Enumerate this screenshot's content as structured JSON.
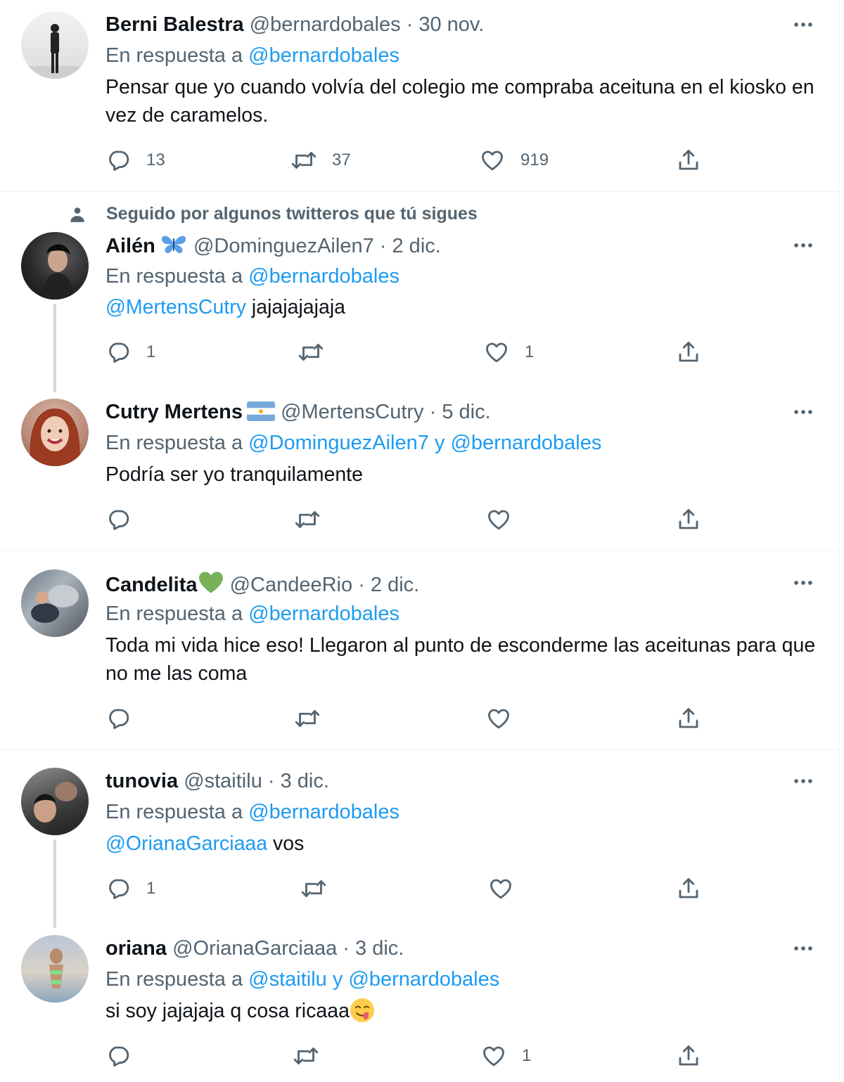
{
  "tweets": [
    {
      "name": "Berni Balestra",
      "handle": "@bernardobales",
      "sep": " · ",
      "date": "30 nov.",
      "reply_prefix": "En respuesta a ",
      "reply_to": "@bernardobales",
      "text": "Pensar que yo cuando volvía del colegio me compraba aceituna en el kiosko en vez de caramelos.",
      "counts": {
        "reply": "13",
        "retweet": "37",
        "like": "919"
      }
    },
    {
      "social_context": "Seguido por algunos twitteros que tú sigues",
      "name": "Ailén",
      "handle": "@DominguezAilen7",
      "sep": " · ",
      "date": "2 dic.",
      "reply_prefix": "En respuesta a ",
      "reply_to": "@bernardobales",
      "text_mention": "@MertensCutry",
      "text": " jajajajajaja",
      "counts": {
        "reply": "1",
        "retweet": "",
        "like": "1"
      }
    },
    {
      "name": "Cutry Mertens",
      "handle": "@MertensCutry",
      "sep": " · ",
      "date": "5 dic.",
      "reply_prefix": "En respuesta a ",
      "reply_to": "@DominguezAilen7 y @bernardobales",
      "text": "Podría ser yo tranquilamente",
      "counts": {
        "reply": "",
        "retweet": "",
        "like": ""
      }
    },
    {
      "name": "Candelita",
      "handle": "@CandeeRio",
      "sep": " · ",
      "date": "2 dic.",
      "reply_prefix": "En respuesta a ",
      "reply_to": "@bernardobales",
      "text": "Toda mi vida hice eso! Llegaron al punto de esconderme las aceitunas para que no me las coma",
      "counts": {
        "reply": "",
        "retweet": "",
        "like": ""
      }
    },
    {
      "name": "tunovia",
      "handle": "@staitilu",
      "sep": " · ",
      "date": "3 dic.",
      "reply_prefix": "En respuesta a ",
      "reply_to": "@bernardobales",
      "text_mention": "@OrianaGarciaaa",
      "text": " vos",
      "counts": {
        "reply": "1",
        "retweet": "",
        "like": ""
      }
    },
    {
      "name": "oriana",
      "handle": "@OrianaGarciaaa",
      "sep": " · ",
      "date": "3 dic.",
      "reply_prefix": "En respuesta a ",
      "reply_to": "@staitilu y @bernardobales",
      "text": "si soy jajajaja q cosa ricaaa",
      "counts": {
        "reply": "",
        "retweet": "",
        "like": "1"
      }
    }
  ],
  "icons": {
    "more": "more-options-icon",
    "reply": "reply-icon",
    "retweet": "retweet-icon",
    "like": "like-icon",
    "share": "share-icon",
    "person": "person-icon",
    "butterfly": "butterfly-emoji",
    "flag": "argentina-flag-emoji",
    "heart": "green-heart-emoji",
    "yum": "yum-face-emoji"
  },
  "colors": {
    "accent": "#1d9bf0",
    "secondary_text": "#536471",
    "primary_text": "#0f1419",
    "divider": "#eff3f4"
  }
}
